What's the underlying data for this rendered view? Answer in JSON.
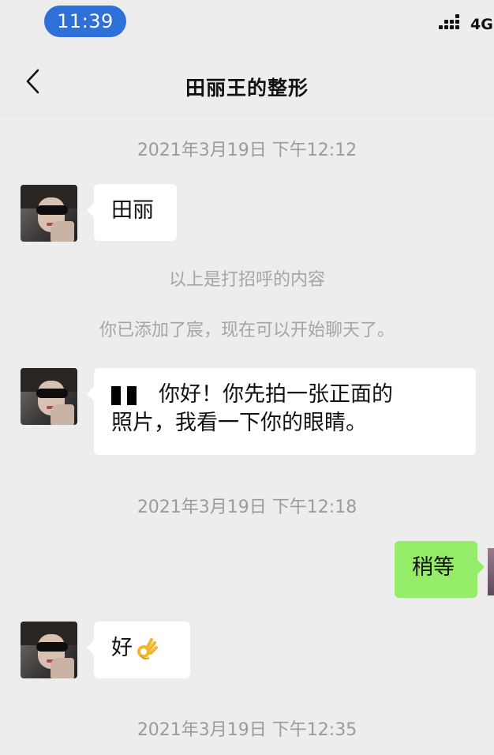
{
  "status_bar": {
    "time": "11:39",
    "network": "4G"
  },
  "nav": {
    "title": "田丽王的整形"
  },
  "messages": {
    "ts1": "2021年3月19日 下午12:12",
    "m1_text": "田丽",
    "sys1": "以上是打招呼的内容",
    "sys2": "你已添加了宸，现在可以开始聊天了。",
    "m2_line1": "你好！你先拍一张正面的",
    "m2_line2": "照片，我看一下你的眼睛。",
    "ts2": "2021年3月19日 下午12:18",
    "m3_text": "稍等",
    "m4_text": "好",
    "m4_emoji": "ok-hand-emoji",
    "ts3": "2021年3月19日 下午12:35"
  },
  "colors": {
    "background": "#ededed",
    "time_pill": "#2f6fd8",
    "incoming_bubble": "#ffffff",
    "outgoing_bubble": "#95ec69",
    "meta_text": "#9b9b9b"
  }
}
